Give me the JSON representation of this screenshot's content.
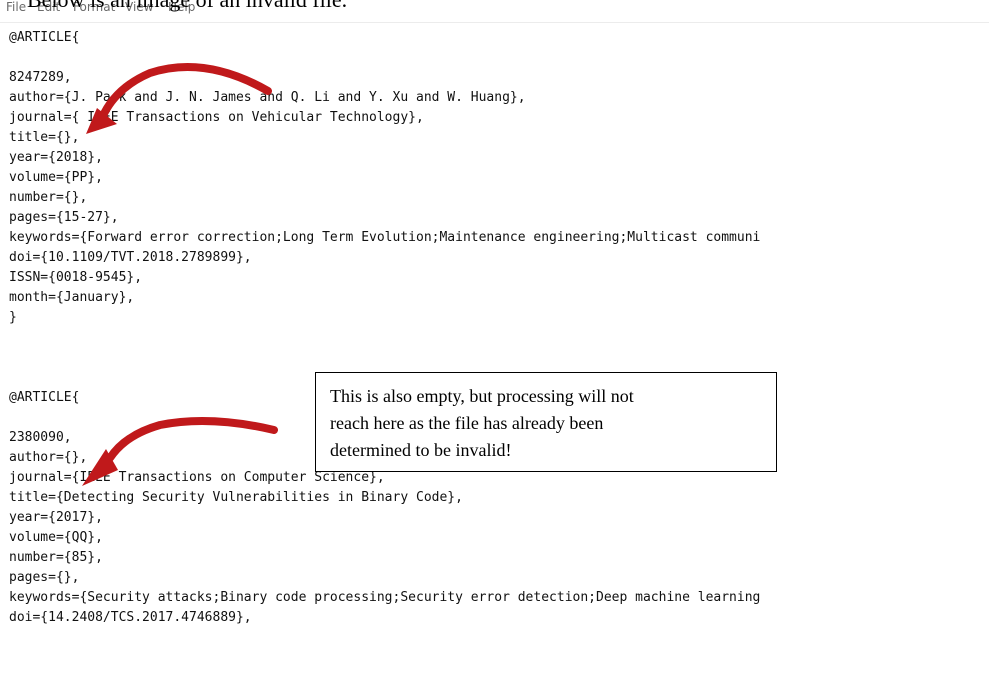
{
  "caption": "Below is an image of an invalid file.",
  "menu": [
    "File",
    "Edit",
    "Format",
    "View",
    "Help"
  ],
  "entries": [
    {
      "lines": [
        "@ARTICLE{",
        "",
        "8247289,",
        "author={J. Park and J. N. James and Q. Li and Y. Xu and W. Huang},",
        "journal={ IEEE Transactions on Vehicular Technology},",
        "title={},",
        "year={2018},",
        "volume={PP},",
        "number={},",
        "pages={15-27},",
        "keywords={Forward error correction;Long Term Evolution;Maintenance engineering;Multicast communi",
        "doi={10.1109/TVT.2018.2789899},",
        "ISSN={0018-9545},",
        "month={January},",
        "}"
      ]
    },
    {
      "lines": [
        "@ARTICLE{",
        "",
        "2380090,",
        "author={},",
        "journal={IEEE Transactions on Computer Science},",
        "title={Detecting Security Vulnerabilities in Binary Code},",
        "year={2017},",
        "volume={QQ},",
        "number={85},",
        "pages={},",
        "keywords={Security attacks;Binary code processing;Security error detection;Deep machine learning",
        "doi={14.2408/TCS.2017.4746889},"
      ]
    }
  ],
  "note": {
    "lines": [
      "This is also empty, but processing will not",
      "reach here as the file has already been",
      "determined to be invalid!"
    ]
  },
  "colors": {
    "arrow": "#c0191b",
    "note_border": "#000000"
  }
}
